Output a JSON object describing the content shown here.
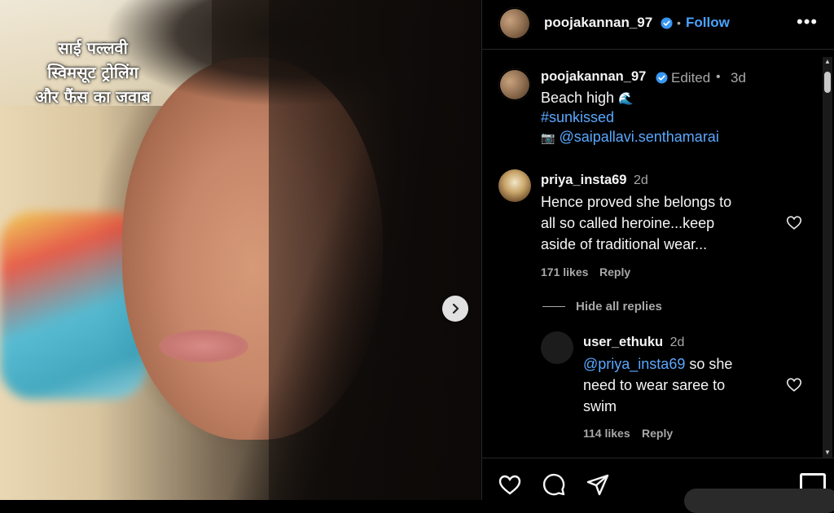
{
  "overlay": {
    "caption_line1": "साई पल्लवी",
    "caption_line2": "स्विमसूट ट्रोलिंग",
    "caption_line3": "और फैंस का जवाब"
  },
  "header": {
    "username": "poojakannan_97",
    "separator": "•",
    "follow_label": "Follow",
    "more_label": "•••"
  },
  "post": {
    "username": "poojakannan_97",
    "edited_label": "Edited",
    "separator": "•",
    "age": "3d",
    "caption_text": "Beach high",
    "caption_emoji": "🌊",
    "hashtag": "#sunkissed",
    "credit_icon": "📷",
    "credit_handle": "@saipallavi.senthamarai"
  },
  "comments": [
    {
      "username": "priya_insta69",
      "age": "2d",
      "line1": "Hence proved she belongs to",
      "line2": "all so called heroine...keep",
      "line3": "aside of traditional wear...",
      "likes": "171 likes",
      "reply_label": "Reply",
      "hide_replies_label": "Hide all replies"
    },
    {
      "username": "user_ethuku",
      "age": "2d",
      "mention": "@priya_insta69",
      "line1_rest": " so she",
      "line2": "need to wear saree to",
      "line3": "swim",
      "likes": "114 likes",
      "reply_label": "Reply"
    }
  ],
  "colors": {
    "accent_blue": "#4aa3ff",
    "verified_blue": "#3897f0",
    "background": "#000000",
    "muted": "#a8a8a8"
  },
  "icons": [
    "verified-badge-icon",
    "heart-icon",
    "comment-icon",
    "share-icon",
    "save-icon",
    "chevron-right-icon",
    "camera-icon",
    "wave-icon"
  ]
}
